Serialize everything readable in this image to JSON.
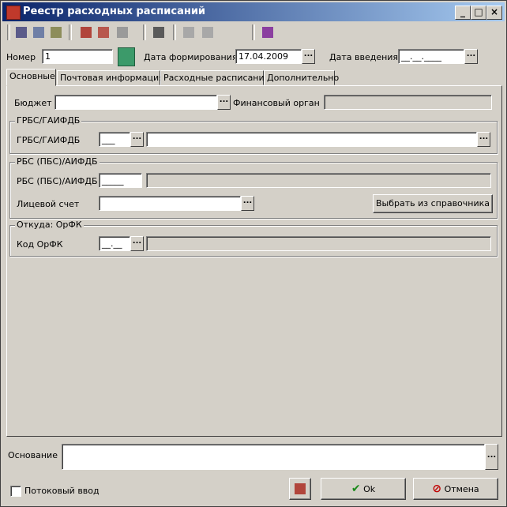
{
  "window": {
    "title": "Реестр расходных расписаний"
  },
  "header": {
    "number_label": "Номер",
    "number_value": "1",
    "date_form_label": "Дата формирования",
    "date_form_value": "17.04.2009",
    "date_intro_label": "Дата введения",
    "date_intro_value": "__.__.____"
  },
  "tabs": [
    "Основные",
    "Почтовая информация",
    "Расходные расписания",
    "Дополнительно"
  ],
  "main": {
    "budget_label": "Бюджет",
    "fin_organ_label": "Финансовый орган",
    "grbs_group_title": "ГРБС/ГАИФДБ",
    "grbs_label": "ГРБС/ГАИФДБ",
    "grbs_code": "___",
    "rbs_group_title": "РБС (ПБС)/АИФДБ",
    "rbs_label": "РБС (ПБС)/АИФДБ",
    "rbs_code": "_____",
    "account_label": "Лицевой счет",
    "choose_button": "Выбрать из справочника",
    "orfk_group_title": "Откуда: ОрФК",
    "orfk_label": "Код ОрФК",
    "orfk_code": "__.__"
  },
  "footer": {
    "basis_label": "Основание",
    "stream_label": "Потоковый ввод",
    "ok_label": "Ok",
    "cancel_label": "Отмена"
  },
  "colors": {
    "title_start": "#0a246a",
    "title_end": "#a6caf0",
    "window_bg": "#d4d0c8"
  }
}
